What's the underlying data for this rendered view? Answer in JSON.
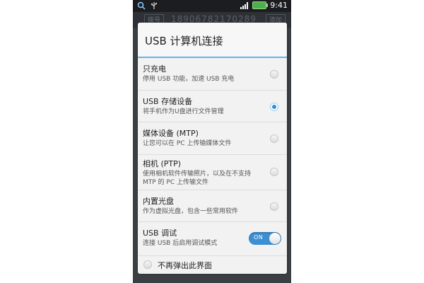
{
  "status_bar": {
    "time": "9:41"
  },
  "background": {
    "left_button": "拨号",
    "number": "18906782170289",
    "right_button": "添加"
  },
  "dialog": {
    "title": "USB 计算机连接",
    "options": [
      {
        "title": "只充电",
        "subtitle": "停用 USB 功能，加速 USB 充电",
        "selected": false
      },
      {
        "title": "USB 存储设备",
        "subtitle": "将手机作为U盘进行文件管理",
        "selected": true
      },
      {
        "title": "媒体设备 (MTP)",
        "subtitle": "让您可以在 PC 上传输媒体文件",
        "selected": false
      },
      {
        "title": "相机 (PTP)",
        "subtitle": "使用相机软件传输照片，以及在不支持 MTP 的 PC 上传输文件",
        "selected": false
      },
      {
        "title": "内置光盘",
        "subtitle": "作为虚拟光盘，包含一些常用软件",
        "selected": false
      }
    ],
    "usb_debug": {
      "title": "USB 调试",
      "subtitle": "连接 USB 后启用调试模式",
      "toggle_label": "ON"
    },
    "footer_label": "不再弹出此界面"
  },
  "colors": {
    "accent": "#2c8fd6",
    "title_divider": "#62b6ea",
    "toggle_on": "#3b8fd2"
  }
}
